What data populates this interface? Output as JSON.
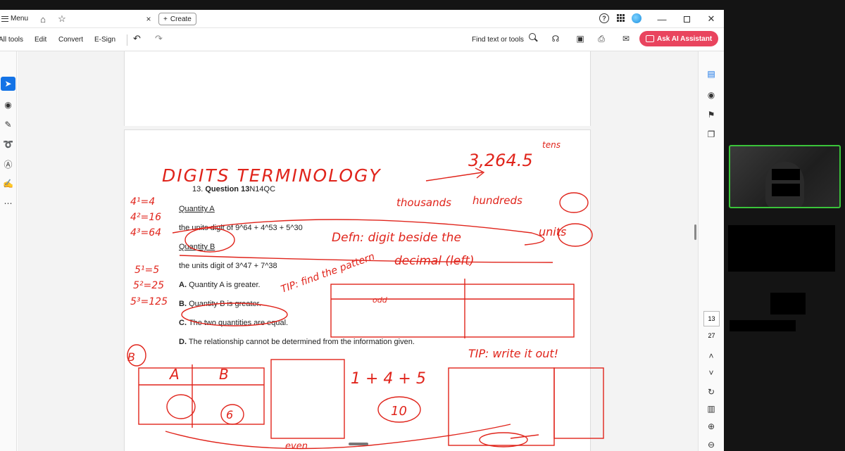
{
  "titlebar": {
    "menu_label": "Menu",
    "create_label": "Create",
    "close_tab": "×",
    "help": "?"
  },
  "toolbar": {
    "all_tools": "All tools",
    "edit": "Edit",
    "convert": "Convert",
    "esign": "E-Sign",
    "find_placeholder": "Find text or tools",
    "ai_assistant": "Ask AI Assistant"
  },
  "document": {
    "question_number": "13.",
    "question_title": "Question 13",
    "question_code": "N14QC",
    "quantity_a_label": "Quantity A",
    "quantity_a_text": "the units digit of 9^64 + 4^53 + 5^30",
    "quantity_b_label": "Quantity B",
    "quantity_b_text": "the units digit of 3^47 + 7^38",
    "options": [
      {
        "letter": "A.",
        "text": "Quantity A is greater."
      },
      {
        "letter": "B.",
        "text": "Quantity B is greater."
      },
      {
        "letter": "C.",
        "text": "The two quantities are equal."
      },
      {
        "letter": "D.",
        "text": "The relationship cannot be determined from the information given."
      }
    ]
  },
  "annotations": {
    "heading": "DIGITS TERMINOLOGY",
    "number_example": "3,264.5",
    "tens": "tens",
    "thousands": "thousands",
    "hundreds": "hundreds",
    "units": "units",
    "definition": "Defn: digit beside the",
    "decimal": "decimal (left)",
    "find_the_pattern": "TIP: find the pattern",
    "write_it_out": "TIP: write it out!",
    "powers_of_4": [
      "4¹=4",
      "4²=16",
      "4³=64"
    ],
    "powers_of_5": [
      "5¹=5",
      "5²=25",
      "5³=125"
    ],
    "sum_a": "1 + 4 + 5",
    "result_a": "10",
    "col_a": "A",
    "col_b": "B",
    "cell_b": "6",
    "answer": "B",
    "even": "even",
    "odd": "odd"
  },
  "pages": {
    "current": "13",
    "total": "27"
  }
}
